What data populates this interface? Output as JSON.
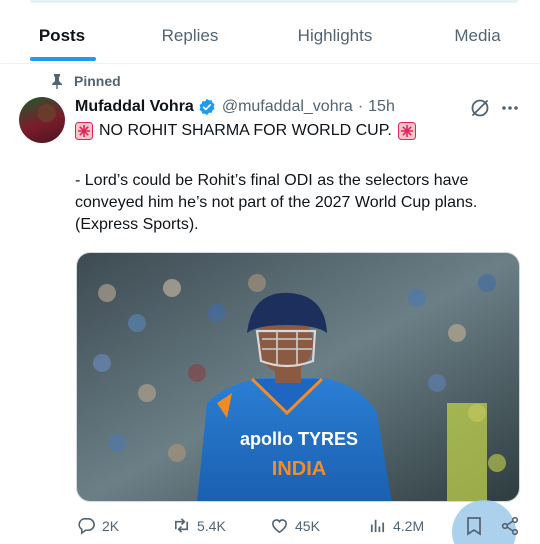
{
  "tabs": [
    {
      "label": "Posts"
    },
    {
      "label": "Replies"
    },
    {
      "label": "Highlights"
    },
    {
      "label": "Media"
    }
  ],
  "pinned_label": "Pinned",
  "post": {
    "author_name": "Mufaddal Vohra",
    "handle": "@mufaddal_vohra",
    "separator": "·",
    "time": "15h",
    "headline": "NO ROHIT SHARMA FOR WORLD CUP.",
    "body": "- Lord’s could be Rohit’s final ODI as the selectors have conveyed him he’s not part of the 2027 World Cup plans. (Express Sports).",
    "image": {
      "jersey_text": "apollo TYRES",
      "jersey_text2": "INDIA"
    }
  },
  "actions": {
    "replies": "2K",
    "reposts": "5.4K",
    "likes": "45K",
    "views": "4.2M"
  },
  "colors": {
    "accent": "#1d9bf0",
    "muted": "#536471",
    "text": "#0f1419",
    "siren": "#e0245e"
  }
}
